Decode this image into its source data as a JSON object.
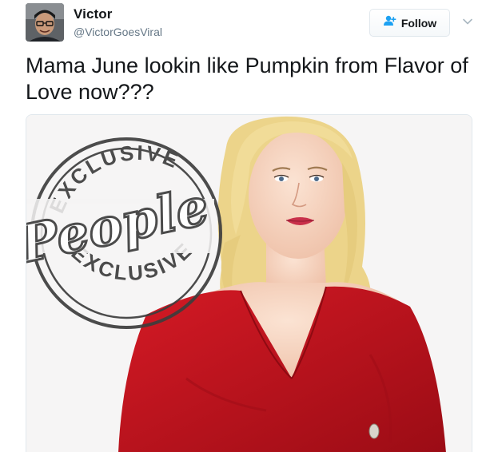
{
  "user": {
    "display_name": "Victor",
    "handle": "@VictorGoesViral"
  },
  "actions": {
    "follow_label": "Follow",
    "follow_icon": "add-user-icon",
    "more_icon": "chevron-down-icon"
  },
  "tweet": {
    "text": "Mama June lookin like Pumpkin from Flavor of Love now???"
  },
  "media": {
    "stamp_top_text": "EXCLUSIVE",
    "stamp_brand": "People",
    "stamp_bottom_text": "EXCLUSIVE",
    "dress_color": "#c2101c",
    "hair_color": "#efd98f"
  },
  "colors": {
    "text_primary": "#14171a",
    "text_secondary": "#657786",
    "accent": "#1da1f2",
    "border": "#e1e8ed"
  }
}
